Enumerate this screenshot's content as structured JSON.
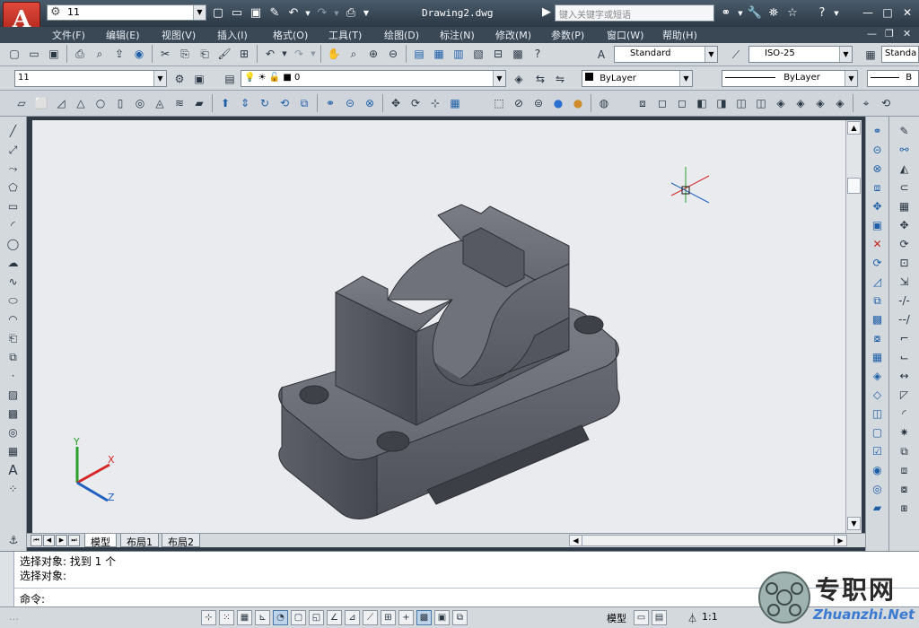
{
  "app": {
    "logo_letter": "A",
    "workspace": "11",
    "doc_title": "Drawing2.dwg",
    "search_placeholder": "键入关键字或短语",
    "window_buttons": [
      "—",
      "□",
      "✕"
    ]
  },
  "menus": [
    "文件(F)",
    "编辑(E)",
    "视图(V)",
    "插入(I)",
    "格式(O)",
    "工具(T)",
    "绘图(D)",
    "标注(N)",
    "修改(M)",
    "参数(P)",
    "窗口(W)",
    "帮助(H)"
  ],
  "styles": {
    "text_style": "Standard",
    "dim_style": "ISO-25",
    "table_style": "Standa"
  },
  "layers": {
    "workspace_combo": "11",
    "layer_name": "0",
    "color": "ByLayer",
    "linetype": "ByLayer",
    "lineweight": "B"
  },
  "layout_tabs": [
    "模型",
    "布局1",
    "布局2"
  ],
  "command": {
    "history": [
      "选择对象: 找到 1 个",
      "选择对象:"
    ],
    "prompt": "命令:"
  },
  "status": {
    "model_label": "模型",
    "annotation_scale": "1:1"
  },
  "ucs": {
    "x": "X",
    "y": "Y",
    "z": "Z"
  },
  "watermark": {
    "zh": "专职网",
    "en": "Zhuanzhi.Net"
  },
  "colors": {
    "accent": "#1e5fa8",
    "model_fill": "#5a5d66",
    "canvas_bg": "#e9ebee"
  }
}
